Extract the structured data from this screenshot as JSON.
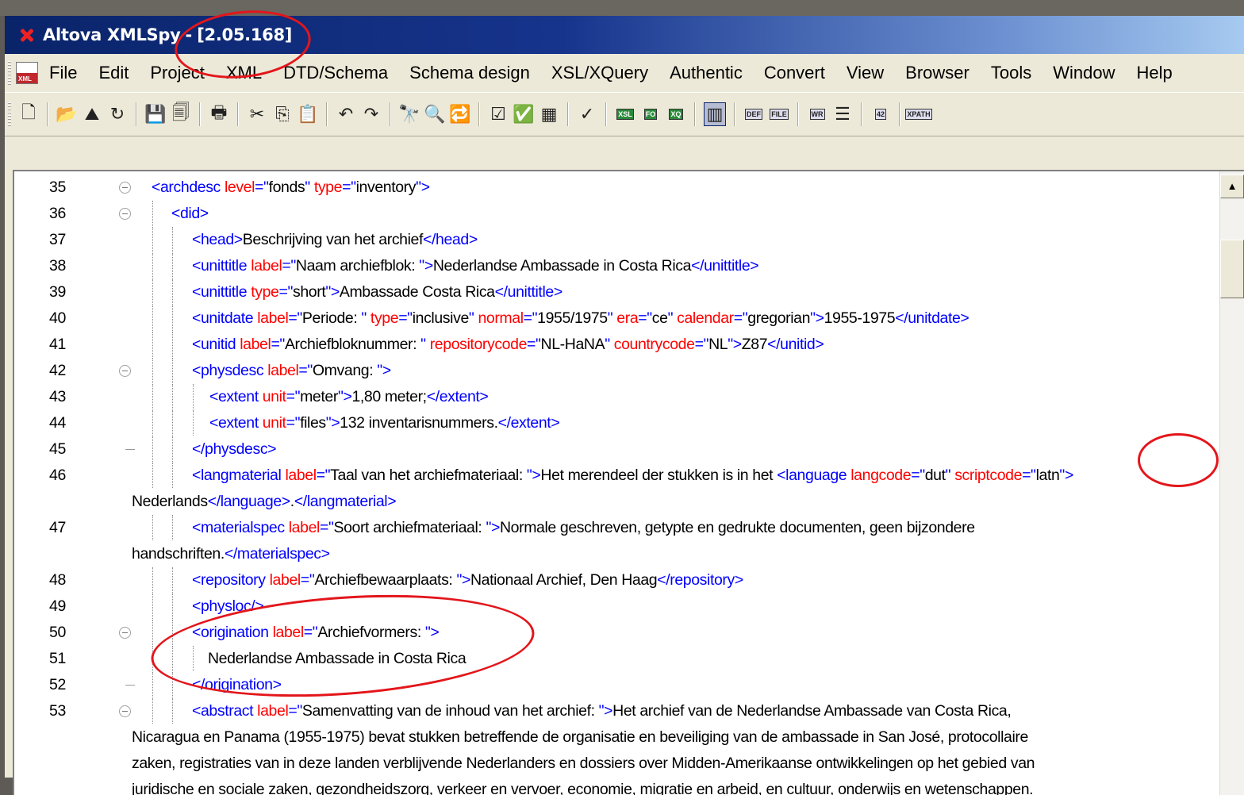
{
  "window": {
    "app_name": "Altova XMLSpy",
    "separator": "-",
    "version": "[2.05.168]"
  },
  "menu": [
    "File",
    "Edit",
    "Project",
    "XML",
    "DTD/Schema",
    "Schema design",
    "XSL/XQuery",
    "Authentic",
    "Convert",
    "View",
    "Browser",
    "Tools",
    "Window",
    "Help"
  ],
  "menu_doc_icon_text": "XML",
  "toolbar": {
    "buttons": [
      {
        "name": "new-file-icon",
        "glyph": "🗋"
      },
      {
        "sep": true
      },
      {
        "name": "open-folder-icon",
        "glyph": "📂"
      },
      {
        "name": "open-url-icon",
        "glyph": "⛰"
      },
      {
        "name": "reload-icon",
        "glyph": "↻"
      },
      {
        "sep": true
      },
      {
        "name": "save-icon",
        "glyph": "💾"
      },
      {
        "name": "save-all-icon",
        "glyph": "🗐"
      },
      {
        "sep": true
      },
      {
        "name": "print-icon",
        "glyph": "🖶"
      },
      {
        "sep": true
      },
      {
        "name": "cut-icon",
        "glyph": "✂"
      },
      {
        "name": "copy-icon",
        "glyph": "⎘"
      },
      {
        "name": "paste-icon",
        "glyph": "📋"
      },
      {
        "sep": true
      },
      {
        "name": "undo-icon",
        "glyph": "↶"
      },
      {
        "name": "redo-icon",
        "glyph": "↷"
      },
      {
        "sep": true
      },
      {
        "name": "find-icon",
        "glyph": "🔭"
      },
      {
        "name": "find-next-icon",
        "glyph": "🔍"
      },
      {
        "name": "replace-icon",
        "glyph": "🔁"
      },
      {
        "sep": true
      },
      {
        "name": "check-wellformed-icon",
        "glyph": "☑"
      },
      {
        "name": "validate-icon",
        "glyph": "✅"
      },
      {
        "name": "project-validate-icon",
        "glyph": "▦"
      },
      {
        "sep": true
      },
      {
        "name": "spellcheck-icon",
        "glyph": "✓"
      },
      {
        "sep": true
      },
      {
        "name": "xsl-transform-icon",
        "mini": "XSL",
        "green": true
      },
      {
        "name": "fo-transform-icon",
        "mini": "FO",
        "green": true
      },
      {
        "name": "xquery-icon",
        "mini": "XQ",
        "green": true
      },
      {
        "sep": true
      },
      {
        "name": "text-view-icon",
        "glyph": "▥",
        "active": true
      },
      {
        "sep": true
      },
      {
        "name": "def-icon",
        "mini": "DEF"
      },
      {
        "name": "file-icon",
        "mini": "FILE"
      },
      {
        "sep": true
      },
      {
        "name": "wrap-icon",
        "mini": "WR"
      },
      {
        "name": "pretty-print-icon",
        "glyph": "☰"
      },
      {
        "sep": true
      },
      {
        "name": "line-numbers-icon",
        "mini": "42"
      },
      {
        "sep": true
      },
      {
        "name": "xpath-icon",
        "mini": "XPATH"
      }
    ]
  },
  "scrollbar": {
    "up_arrow": "▲"
  },
  "editor": {
    "lines": [
      {
        "num": "35",
        "fold": "open",
        "guides": [],
        "indent": 185,
        "parts": [
          [
            "tg",
            "<archdesc "
          ],
          [
            "an",
            "level"
          ],
          [
            "tg",
            "=\""
          ],
          [
            "av",
            "fonds"
          ],
          [
            "tg",
            "\" "
          ],
          [
            "an",
            "type"
          ],
          [
            "tg",
            "=\""
          ],
          [
            "av",
            "inventory"
          ],
          [
            "tg",
            "\">"
          ]
        ]
      },
      {
        "num": "36",
        "fold": "open",
        "guides": [
          186
        ],
        "indent": 210,
        "parts": [
          [
            "tg",
            "<did>"
          ]
        ]
      },
      {
        "num": "37",
        "fold": "",
        "guides": [
          186,
          211
        ],
        "indent": 236,
        "parts": [
          [
            "tg",
            "<head>"
          ],
          [
            "tx",
            "Beschrijving van het archief"
          ],
          [
            "tg",
            "</head>"
          ]
        ]
      },
      {
        "num": "38",
        "fold": "",
        "guides": [
          186,
          211
        ],
        "indent": 236,
        "parts": [
          [
            "tg",
            "<unittitle "
          ],
          [
            "an",
            "label"
          ],
          [
            "tg",
            "=\""
          ],
          [
            "av",
            "Naam archiefblok: "
          ],
          [
            "tg",
            "\">"
          ],
          [
            "tx",
            "Nederlandse Ambassade in Costa Rica"
          ],
          [
            "tg",
            "</unittitle>"
          ]
        ]
      },
      {
        "num": "39",
        "fold": "",
        "guides": [
          186,
          211
        ],
        "indent": 236,
        "parts": [
          [
            "tg",
            "<unittitle "
          ],
          [
            "an",
            "type"
          ],
          [
            "tg",
            "=\""
          ],
          [
            "av",
            "short"
          ],
          [
            "tg",
            "\">"
          ],
          [
            "tx",
            "Ambassade Costa Rica"
          ],
          [
            "tg",
            "</unittitle>"
          ]
        ]
      },
      {
        "num": "40",
        "fold": "",
        "guides": [
          186,
          211
        ],
        "indent": 236,
        "parts": [
          [
            "tg",
            "<unitdate "
          ],
          [
            "an",
            "label"
          ],
          [
            "tg",
            "=\""
          ],
          [
            "av",
            "Periode: "
          ],
          [
            "tg",
            "\" "
          ],
          [
            "an",
            "type"
          ],
          [
            "tg",
            "=\""
          ],
          [
            "av",
            "inclusive"
          ],
          [
            "tg",
            "\" "
          ],
          [
            "an",
            "normal"
          ],
          [
            "tg",
            "=\""
          ],
          [
            "av",
            "1955/1975"
          ],
          [
            "tg",
            "\" "
          ],
          [
            "an",
            "era"
          ],
          [
            "tg",
            "=\""
          ],
          [
            "av",
            "ce"
          ],
          [
            "tg",
            "\" "
          ],
          [
            "an",
            "calendar"
          ],
          [
            "tg",
            "=\""
          ],
          [
            "av",
            "gregorian"
          ],
          [
            "tg",
            "\">"
          ],
          [
            "tx",
            "1955-1975"
          ],
          [
            "tg",
            "</unitdate>"
          ]
        ]
      },
      {
        "num": "41",
        "fold": "",
        "guides": [
          186,
          211
        ],
        "indent": 236,
        "parts": [
          [
            "tg",
            "<unitid "
          ],
          [
            "an",
            "label"
          ],
          [
            "tg",
            "=\""
          ],
          [
            "av",
            "Archiefbloknummer: "
          ],
          [
            "tg",
            "\" "
          ],
          [
            "an",
            "repositorycode"
          ],
          [
            "tg",
            "=\""
          ],
          [
            "av",
            "NL-HaNA"
          ],
          [
            "tg",
            "\" "
          ],
          [
            "an",
            "countrycode"
          ],
          [
            "tg",
            "=\""
          ],
          [
            "av",
            "NL"
          ],
          [
            "tg",
            "\">"
          ],
          [
            "tx",
            "Z87"
          ],
          [
            "tg",
            "</unitid>"
          ]
        ]
      },
      {
        "num": "42",
        "fold": "open",
        "guides": [
          186,
          211
        ],
        "indent": 236,
        "parts": [
          [
            "tg",
            "<physdesc "
          ],
          [
            "an",
            "label"
          ],
          [
            "tg",
            "=\""
          ],
          [
            "av",
            "Omvang: "
          ],
          [
            "tg",
            "\">"
          ]
        ]
      },
      {
        "num": "43",
        "fold": "",
        "guides": [
          186,
          211,
          237
        ],
        "indent": 258,
        "parts": [
          [
            "tg",
            "<extent "
          ],
          [
            "an",
            "unit"
          ],
          [
            "tg",
            "=\""
          ],
          [
            "av",
            "meter"
          ],
          [
            "tg",
            "\">"
          ],
          [
            "tx",
            "1,80 meter;"
          ],
          [
            "tg",
            "</extent>"
          ]
        ]
      },
      {
        "num": "44",
        "fold": "",
        "guides": [
          186,
          211,
          237
        ],
        "indent": 258,
        "parts": [
          [
            "tg",
            "<extent "
          ],
          [
            "an",
            "unit"
          ],
          [
            "tg",
            "=\""
          ],
          [
            "av",
            "files"
          ],
          [
            "tg",
            "\">"
          ],
          [
            "tx",
            "132 inventarisnummers."
          ],
          [
            "tg",
            "</extent>"
          ]
        ]
      },
      {
        "num": "45",
        "fold": "end",
        "guides": [
          186,
          211
        ],
        "indent": 236,
        "parts": [
          [
            "tg",
            "</physdesc>"
          ]
        ]
      },
      {
        "num": "46",
        "fold": "",
        "guides": [
          186,
          211
        ],
        "indent": 236,
        "parts": [
          [
            "tg",
            "<langmaterial "
          ],
          [
            "an",
            "label"
          ],
          [
            "tg",
            "=\""
          ],
          [
            "av",
            "Taal van het archiefmateriaal: "
          ],
          [
            "tg",
            "\">"
          ],
          [
            "tx",
            "Het merendeel der stukken is in het "
          ],
          [
            "tg",
            "<language "
          ],
          [
            "an",
            "langcode"
          ],
          [
            "tg",
            "=\""
          ],
          [
            "av",
            "dut"
          ],
          [
            "tg",
            "\" "
          ],
          [
            "an",
            "scriptcode"
          ],
          [
            "tg",
            "=\""
          ],
          [
            "av",
            "latn"
          ],
          [
            "tg",
            "\">"
          ]
        ]
      },
      {
        "num": "",
        "fold": "",
        "guides": [],
        "indent": 160,
        "parts": [
          [
            "tx",
            "Nederlands"
          ],
          [
            "tg",
            "</language>"
          ],
          [
            "tx",
            "."
          ],
          [
            "tg",
            "</langmaterial>"
          ]
        ]
      },
      {
        "num": "47",
        "fold": "",
        "guides": [
          186,
          211
        ],
        "indent": 236,
        "parts": [
          [
            "tg",
            "<materialspec "
          ],
          [
            "an",
            "label"
          ],
          [
            "tg",
            "=\""
          ],
          [
            "av",
            "Soort archiefmateriaal: "
          ],
          [
            "tg",
            "\">"
          ],
          [
            "tx",
            "Normale geschreven, getypte en gedrukte documenten, geen bijzondere"
          ]
        ]
      },
      {
        "num": "",
        "fold": "",
        "guides": [],
        "indent": 160,
        "parts": [
          [
            "tx",
            "handschriften."
          ],
          [
            "tg",
            "</materialspec>"
          ]
        ]
      },
      {
        "num": "48",
        "fold": "",
        "guides": [
          186,
          211
        ],
        "indent": 236,
        "parts": [
          [
            "tg",
            "<repository "
          ],
          [
            "an",
            "label"
          ],
          [
            "tg",
            "=\""
          ],
          [
            "av",
            "Archiefbewaarplaats: "
          ],
          [
            "tg",
            "\">"
          ],
          [
            "tx",
            "Nationaal Archief, Den Haag"
          ],
          [
            "tg",
            "</repository>"
          ]
        ]
      },
      {
        "num": "49",
        "fold": "",
        "guides": [
          186,
          211
        ],
        "indent": 236,
        "parts": [
          [
            "tg",
            "<physloc/>"
          ]
        ]
      },
      {
        "num": "50",
        "fold": "open",
        "guides": [
          186,
          211
        ],
        "indent": 236,
        "parts": [
          [
            "tg",
            "<origination "
          ],
          [
            "an",
            "label"
          ],
          [
            "tg",
            "=\""
          ],
          [
            "av",
            "Archiefvormers: "
          ],
          [
            "tg",
            "\">"
          ]
        ]
      },
      {
        "num": "51",
        "fold": "",
        "guides": [
          186,
          211,
          237
        ],
        "indent": 256,
        "parts": [
          [
            "tx",
            "Nederlandse Ambassade in Costa Rica"
          ]
        ]
      },
      {
        "num": "52",
        "fold": "end",
        "guides": [
          186,
          211
        ],
        "indent": 236,
        "parts": [
          [
            "tg",
            "</origination>"
          ]
        ]
      },
      {
        "num": "53",
        "fold": "open",
        "guides": [
          186,
          211
        ],
        "indent": 236,
        "parts": [
          [
            "tg",
            "<abstract "
          ],
          [
            "an",
            "label"
          ],
          [
            "tg",
            "=\""
          ],
          [
            "av",
            "Samenvatting van de inhoud van het archief: "
          ],
          [
            "tg",
            "\">"
          ],
          [
            "tx",
            "Het archief van de Nederlandse Ambassade van Costa Rica,"
          ]
        ]
      },
      {
        "num": "",
        "fold": "",
        "guides": [],
        "indent": 160,
        "parts": [
          [
            "tx",
            "Nicaragua en Panama (1955-1975) bevat stukken betreffende de organisatie en beveiliging van de ambassade in San José, protocollaire"
          ]
        ]
      },
      {
        "num": "",
        "fold": "",
        "guides": [],
        "indent": 160,
        "parts": [
          [
            "tx",
            "zaken, registraties van in deze landen verblijvende Nederlanders en dossiers over Midden-Amerikaanse ontwikkelingen op het gebied van"
          ]
        ]
      },
      {
        "num": "",
        "fold": "",
        "guides": [],
        "indent": 160,
        "parts": [
          [
            "tx",
            "juridische en sociale zaken, gezondheidszorg, verkeer en vervoer, economie, migratie en arbeid, en cultuur, onderwijs en wetenschappen."
          ]
        ]
      }
    ]
  },
  "annotation_color": "#e3161b"
}
